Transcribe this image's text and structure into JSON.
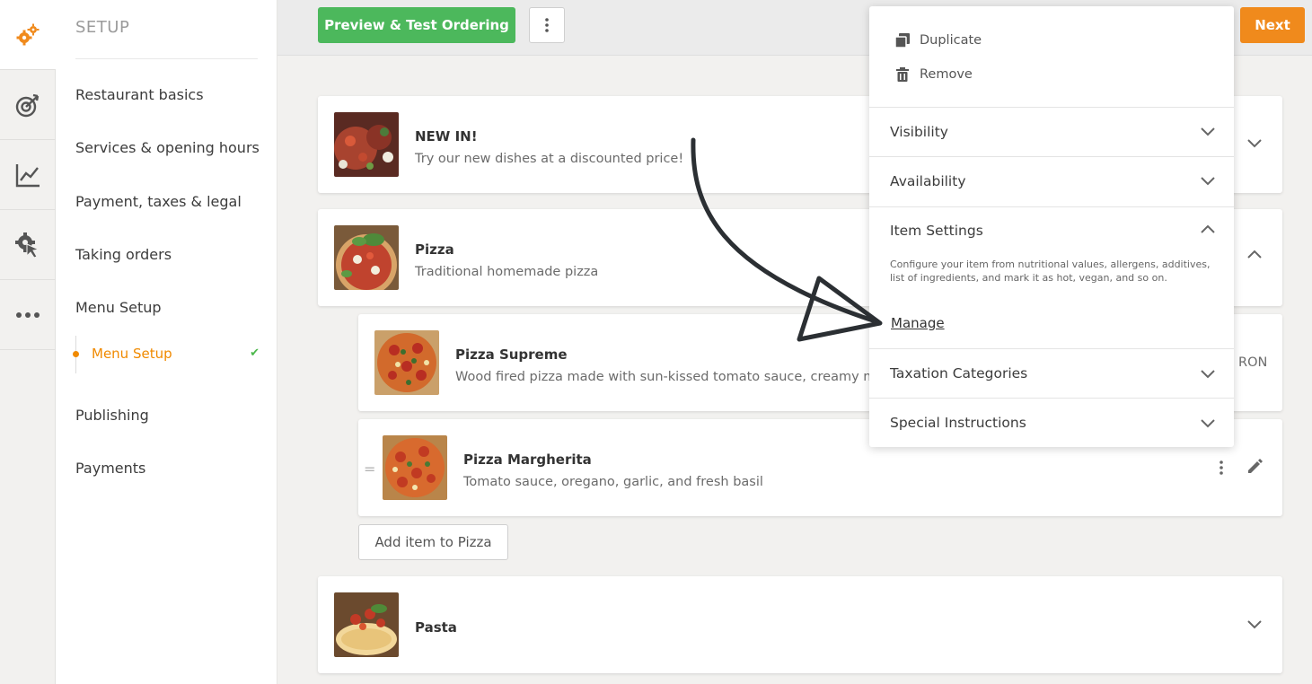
{
  "sidebar": {
    "title": "SETUP",
    "items": [
      {
        "label": "Restaurant basics"
      },
      {
        "label": "Services & opening hours"
      },
      {
        "label": "Payment, taxes & legal"
      },
      {
        "label": "Taking orders"
      },
      {
        "label": "Menu Setup"
      }
    ],
    "sub_item": {
      "label": "Menu Setup",
      "check": "✔"
    },
    "items_after": [
      {
        "label": "Publishing"
      },
      {
        "label": "Payments"
      }
    ]
  },
  "rail": {
    "icons": [
      "gears-icon",
      "target-icon",
      "chart-icon",
      "cursor-gear-icon",
      "more-icon"
    ]
  },
  "toolbar": {
    "preview_label": "Preview & Test Ordering",
    "next_label": "Next"
  },
  "categories": [
    {
      "title": "NEW IN!",
      "desc": "Try our new dishes at a discounted price!"
    },
    {
      "title": "Pizza",
      "desc": "Traditional homemade pizza"
    },
    {
      "title": "Pasta",
      "desc": ""
    }
  ],
  "items": [
    {
      "title": "Pizza Supreme",
      "desc": "Wood fired pizza made with sun-kissed tomato sauce, creamy mozza",
      "price_fragment": "RON"
    },
    {
      "title": "Pizza Margherita",
      "desc": "Tomato sauce, oregano, garlic, and fresh basil",
      "drag": "="
    }
  ],
  "add_item_label": "Add item to Pizza",
  "menu": {
    "duplicate_label": "Duplicate",
    "remove_label": "Remove",
    "sections": [
      {
        "label": "Visibility",
        "state": "collapsed"
      },
      {
        "label": "Availability",
        "state": "collapsed"
      },
      {
        "label": "Item Settings",
        "state": "expanded"
      },
      {
        "label": "Taxation Categories",
        "state": "collapsed"
      },
      {
        "label": "Special Instructions",
        "state": "collapsed"
      }
    ],
    "item_settings_info": "Configure your item from nutritional values, allergens, additives, list of ingredients, and mark it as hot, vegan, and so on.",
    "manage_label": "Manage"
  },
  "colors": {
    "accent_orange": "#f08a1c",
    "preview_green": "#4cb85c",
    "check_green": "#4cb84c",
    "background": "#f2f1ef"
  }
}
